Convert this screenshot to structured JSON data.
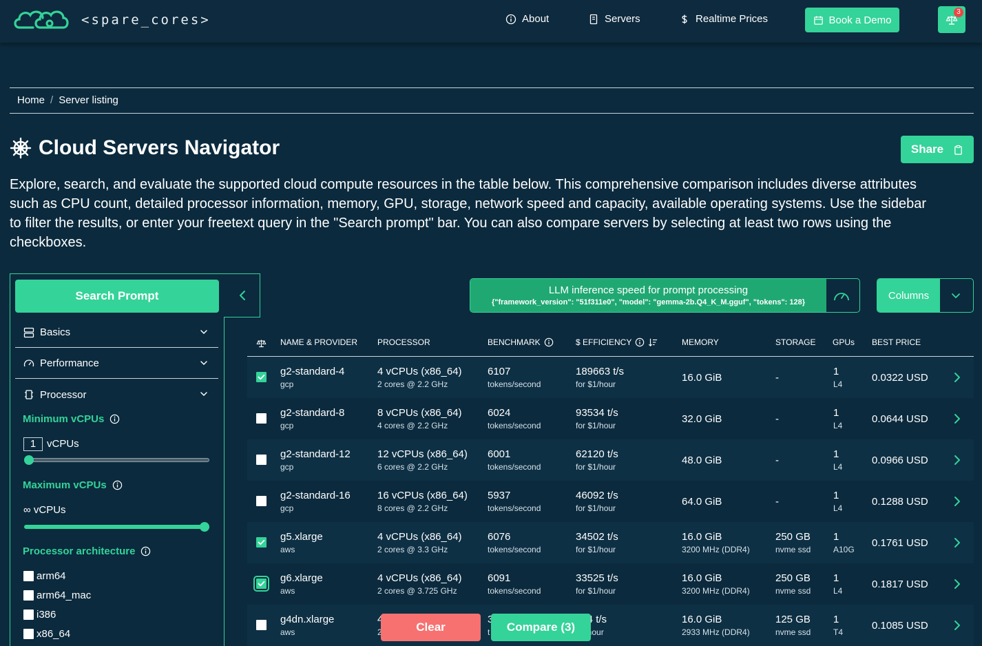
{
  "nav": {
    "brand": "<spare_cores>",
    "about": "About",
    "servers": "Servers",
    "realtime_prices": "Realtime Prices",
    "book_demo": "Book a Demo",
    "compare_count": "3"
  },
  "breadcrumb": {
    "home": "Home",
    "separator": "/",
    "current": "Server listing"
  },
  "page": {
    "title": "Cloud Servers Navigator",
    "share": "Share",
    "intro": "Explore, search, and evaluate the supported cloud compute resources in the table below. This comprehensive comparison includes diverse attributes such as CPU count, detailed processor information, memory, GPU, storage, network speed and capacity, available operating systems. Use the sidebar to filter the results, or enter your freetext query in the \"Search prompt\" bar. You can also compare servers by selecting at least two rows using the checkboxes."
  },
  "sidebar": {
    "search_prompt": "Search Prompt",
    "sections": {
      "basics": "Basics",
      "performance": "Performance",
      "processor": "Processor"
    },
    "min_vcpus": {
      "label": "Minimum vCPUs",
      "value": "1",
      "unit": "vCPUs",
      "level": 0.0
    },
    "max_vcpus": {
      "label": "Maximum vCPUs",
      "value": "∞ vCPUs",
      "level": 1.0
    },
    "architecture": {
      "label": "Processor architecture",
      "options": [
        "arm64",
        "arm64_mac",
        "i386",
        "x86_64"
      ]
    }
  },
  "benchmark_selector": {
    "title": "LLM inference speed for prompt processing",
    "config": "{\"framework_version\": \"51f311e0\", \"model\": \"gemma-2b.Q4_K_M.gguf\", \"tokens\": 128}"
  },
  "columns_button": "Columns",
  "table": {
    "headers": {
      "name": "NAME & PROVIDER",
      "processor": "PROCESSOR",
      "benchmark": "BENCHMARK",
      "efficiency": "$ EFFICIENCY",
      "memory": "MEMORY",
      "storage": "STORAGE",
      "gpus": "GPUs",
      "best_price": "BEST PRICE"
    },
    "rows": [
      {
        "checked": true,
        "name": "g2-standard-4",
        "provider": "gcp",
        "vcpus": "4 vCPUs (x86_64)",
        "cores": "2 cores @ 2.2 GHz",
        "benchmark": "6107",
        "bench_unit": "tokens/second",
        "efficiency": "189663 t/s",
        "eff_unit": "for $1/hour",
        "memory": "16.0 GiB",
        "memory_sub": "",
        "storage": "-",
        "storage_sub": "",
        "gpus": "1",
        "gpu_model": "L4",
        "price": "0.0322 USD"
      },
      {
        "checked": false,
        "name": "g2-standard-8",
        "provider": "gcp",
        "vcpus": "8 vCPUs (x86_64)",
        "cores": "4 cores @ 2.2 GHz",
        "benchmark": "6024",
        "bench_unit": "tokens/second",
        "efficiency": "93534 t/s",
        "eff_unit": "for $1/hour",
        "memory": "32.0 GiB",
        "memory_sub": "",
        "storage": "-",
        "storage_sub": "",
        "gpus": "1",
        "gpu_model": "L4",
        "price": "0.0644 USD"
      },
      {
        "checked": false,
        "name": "g2-standard-12",
        "provider": "gcp",
        "vcpus": "12 vCPUs (x86_64)",
        "cores": "6 cores @ 2.2 GHz",
        "benchmark": "6001",
        "bench_unit": "tokens/second",
        "efficiency": "62120 t/s",
        "eff_unit": "for $1/hour",
        "memory": "48.0 GiB",
        "memory_sub": "",
        "storage": "-",
        "storage_sub": "",
        "gpus": "1",
        "gpu_model": "L4",
        "price": "0.0966 USD"
      },
      {
        "checked": false,
        "name": "g2-standard-16",
        "provider": "gcp",
        "vcpus": "16 vCPUs (x86_64)",
        "cores": "8 cores @ 2.2 GHz",
        "benchmark": "5937",
        "bench_unit": "tokens/second",
        "efficiency": "46092 t/s",
        "eff_unit": "for $1/hour",
        "memory": "64.0 GiB",
        "memory_sub": "",
        "storage": "-",
        "storage_sub": "",
        "gpus": "1",
        "gpu_model": "L4",
        "price": "0.1288 USD"
      },
      {
        "checked": true,
        "name": "g5.xlarge",
        "provider": "aws",
        "vcpus": "4 vCPUs (x86_64)",
        "cores": "2 cores @ 3.3 GHz",
        "benchmark": "6076",
        "bench_unit": "tokens/second",
        "efficiency": "34502 t/s",
        "eff_unit": "for $1/hour",
        "memory": "16.0 GiB",
        "memory_sub": "3200 MHz (DDR4)",
        "storage": "250 GB",
        "storage_sub": "nvme ssd",
        "gpus": "1",
        "gpu_model": "A10G",
        "price": "0.1761 USD"
      },
      {
        "checked": true,
        "name": "g6.xlarge",
        "provider": "aws",
        "vcpus": "4 vCPUs (x86_64)",
        "cores": "2 cores @ 3.725 GHz",
        "benchmark": "6091",
        "bench_unit": "tokens/second",
        "efficiency": "33525 t/s",
        "eff_unit": "for $1/hour",
        "memory": "16.0 GiB",
        "memory_sub": "3200 MHz (DDR4)",
        "storage": "250 GB",
        "storage_sub": "nvme ssd",
        "gpus": "1",
        "gpu_model": "L4",
        "price": "0.1817 USD"
      },
      {
        "checked": false,
        "name": "g4dn.xlarge",
        "provider": "aws",
        "vcpus": "4",
        "cores": "2",
        "benchmark": "3",
        "bench_unit": "t",
        "efficiency": "394 t/s",
        "eff_unit": "$1/hour",
        "memory": "16.0 GiB",
        "memory_sub": "2933 MHz (DDR4)",
        "storage": "125 GB",
        "storage_sub": "nvme ssd",
        "gpus": "1",
        "gpu_model": "T4",
        "price": "0.1085 USD"
      }
    ]
  },
  "actions": {
    "clear": "Clear",
    "compare": "Compare (3)"
  },
  "colors": {
    "accent": "#34d399",
    "background": "#0b2a3d",
    "danger": "#f87171"
  }
}
